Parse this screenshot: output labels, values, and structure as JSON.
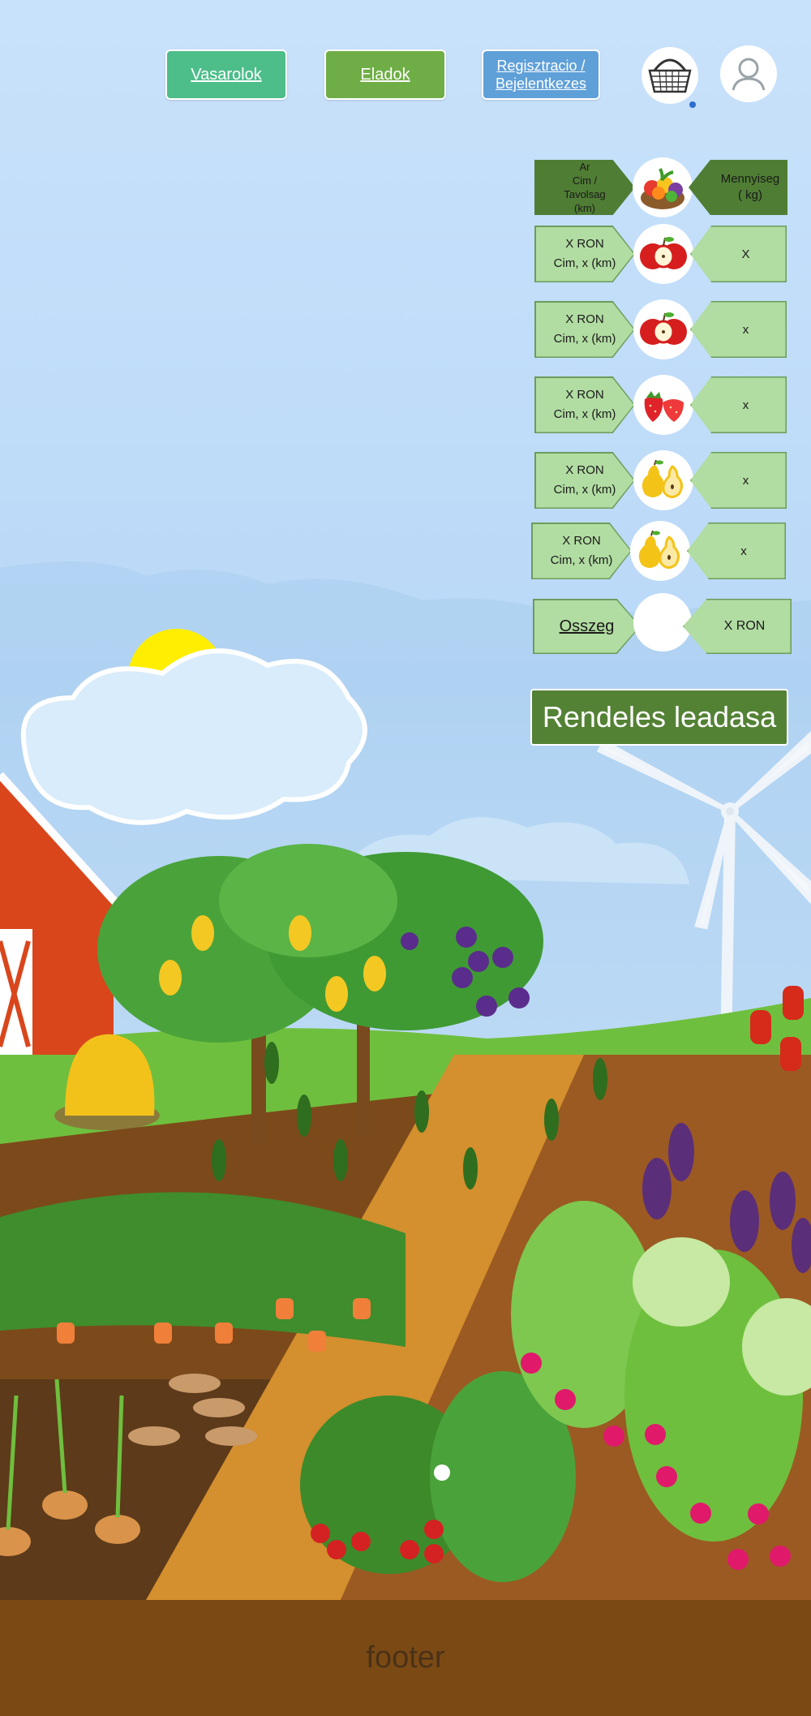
{
  "nav": {
    "buyers_label": "Vasarolok",
    "sellers_label": "Eladok",
    "register_line1": "Regisztracio /",
    "register_line2": "Bejelentkezes"
  },
  "icons": {
    "basket": "basket-icon",
    "user": "user-icon"
  },
  "table": {
    "header": {
      "price_line1": "Ar",
      "price_line2": "Cim /",
      "price_line3": "Tavolsag",
      "price_line4": "(km)",
      "quantity_line1": "Mennyiseg",
      "quantity_line2": "( kg)"
    },
    "rows": [
      {
        "price": "X RON",
        "address": "Cim, x (km)",
        "fruit": "apple",
        "quantity": "X"
      },
      {
        "price": "X RON",
        "address": "Cim, x (km)",
        "fruit": "apple",
        "quantity": "x"
      },
      {
        "price": "X RON",
        "address": "Cim, x (km)",
        "fruit": "strawberry",
        "quantity": "x"
      },
      {
        "price": "X RON",
        "address": "Cim, x (km)",
        "fruit": "pear",
        "quantity": "x"
      },
      {
        "price": "X RON",
        "address": "Cim, x (km)",
        "fruit": "pear",
        "quantity": "x"
      }
    ],
    "total_label": "Osszeg",
    "total_value": "X RON"
  },
  "order_button": "Rendeles leadasa",
  "footer": "footer",
  "colors": {
    "buyers_btn": "#4dbd8a",
    "sellers_btn": "#6fae46",
    "register_btn": "#5fa0d8",
    "table_dark": "#4f7d34",
    "table_light": "#b1dca2",
    "order_btn": "#548235",
    "footer_bg": "#7b4a14"
  }
}
